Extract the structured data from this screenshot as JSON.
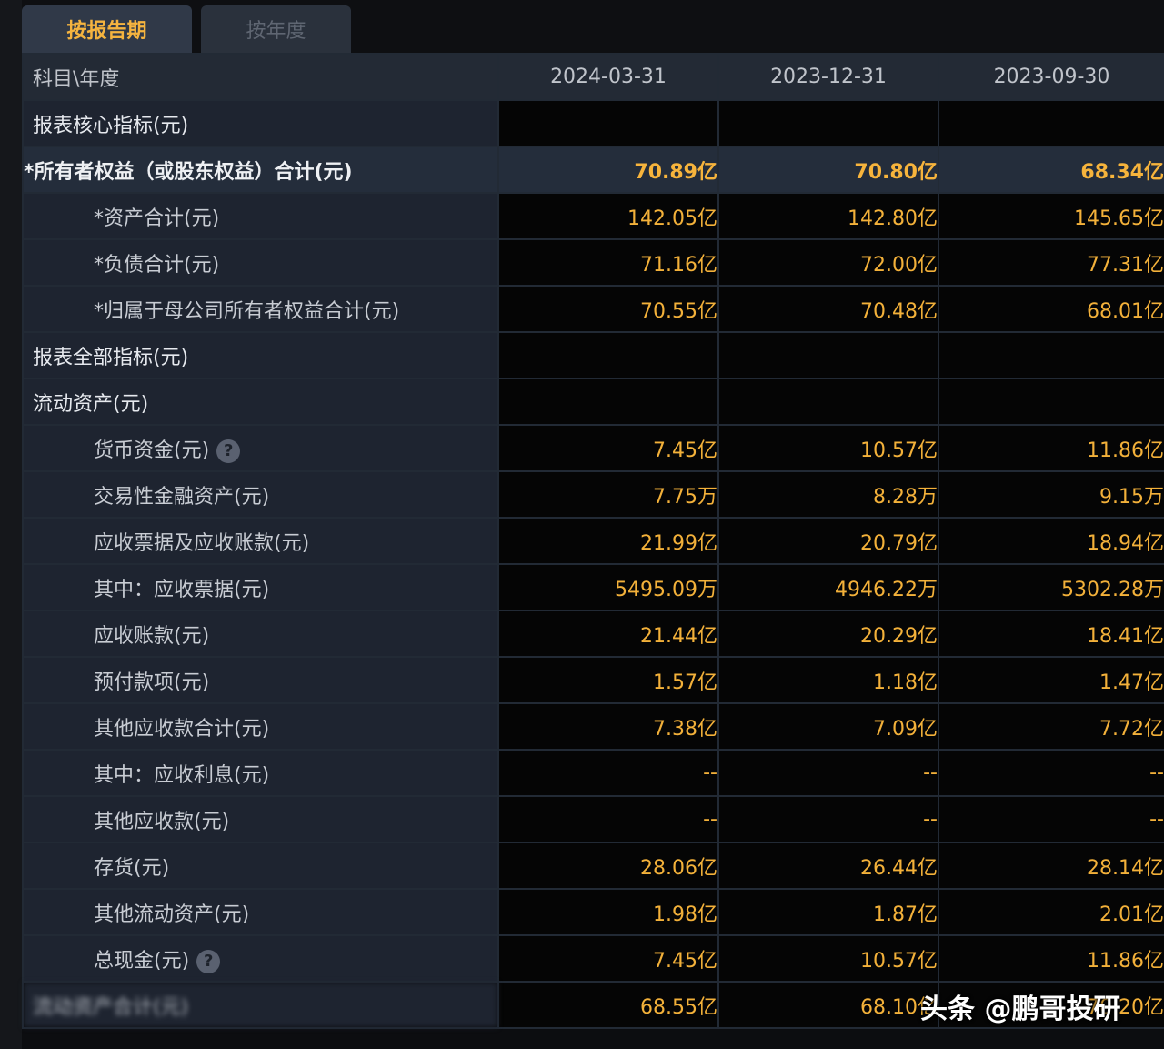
{
  "tabs": [
    {
      "label": "按报告期",
      "active": true
    },
    {
      "label": "按年度",
      "active": false
    }
  ],
  "table": {
    "header_label": "科目\\年度",
    "dates": [
      "2024-03-31",
      "2023-12-31",
      "2023-09-30"
    ],
    "rows": [
      {
        "label": "报表核心指标(元)",
        "kind": "section",
        "values": [
          "",
          "",
          ""
        ]
      },
      {
        "label": "*所有者权益（或股东权益）合计(元)",
        "kind": "highlight",
        "values": [
          "70.89亿",
          "70.80亿",
          "68.34亿"
        ]
      },
      {
        "label": "*资产合计(元)",
        "kind": "item",
        "values": [
          "142.05亿",
          "142.80亿",
          "145.65亿"
        ]
      },
      {
        "label": "*负债合计(元)",
        "kind": "item",
        "values": [
          "71.16亿",
          "72.00亿",
          "77.31亿"
        ]
      },
      {
        "label": "*归属于母公司所有者权益合计(元)",
        "kind": "item",
        "values": [
          "70.55亿",
          "70.48亿",
          "68.01亿"
        ]
      },
      {
        "label": "报表全部指标(元)",
        "kind": "section",
        "values": [
          "",
          "",
          ""
        ]
      },
      {
        "label": "流动资产(元)",
        "kind": "section",
        "values": [
          "",
          "",
          ""
        ]
      },
      {
        "label": "货币资金(元)",
        "kind": "item",
        "help": true,
        "values": [
          "7.45亿",
          "10.57亿",
          "11.86亿"
        ]
      },
      {
        "label": "交易性金融资产(元)",
        "kind": "item",
        "values": [
          "7.75万",
          "8.28万",
          "9.15万"
        ]
      },
      {
        "label": "应收票据及应收账款(元)",
        "kind": "item",
        "values": [
          "21.99亿",
          "20.79亿",
          "18.94亿"
        ]
      },
      {
        "label": "其中：应收票据(元)",
        "kind": "item",
        "values": [
          "5495.09万",
          "4946.22万",
          "5302.28万"
        ]
      },
      {
        "label": "应收账款(元)",
        "kind": "item",
        "values": [
          "21.44亿",
          "20.29亿",
          "18.41亿"
        ]
      },
      {
        "label": "预付款项(元)",
        "kind": "item",
        "values": [
          "1.57亿",
          "1.18亿",
          "1.47亿"
        ]
      },
      {
        "label": "其他应收款合计(元)",
        "kind": "item",
        "values": [
          "7.38亿",
          "7.09亿",
          "7.72亿"
        ]
      },
      {
        "label": "其中：应收利息(元)",
        "kind": "item",
        "values": [
          "--",
          "--",
          "--"
        ]
      },
      {
        "label": "其他应收款(元)",
        "kind": "item",
        "values": [
          "--",
          "--",
          "--"
        ]
      },
      {
        "label": "存货(元)",
        "kind": "item",
        "values": [
          "28.06亿",
          "26.44亿",
          "28.14亿"
        ]
      },
      {
        "label": "其他流动资产(元)",
        "kind": "item",
        "values": [
          "1.98亿",
          "1.87亿",
          "2.01亿"
        ]
      },
      {
        "label": "总现金(元)",
        "kind": "item",
        "help": true,
        "values": [
          "7.45亿",
          "10.57亿",
          "11.86亿"
        ]
      },
      {
        "label": "流动资产合计(元)",
        "kind": "blurred",
        "values": [
          "68.55亿",
          "68.10亿",
          "70.20亿"
        ]
      }
    ]
  },
  "help_icon_glyph": "?",
  "watermark": "头条 @鹏哥投研",
  "colors": {
    "value_text": "#f3b13a",
    "active_tab_text": "#f5b43f",
    "label_bg": "#1e2430",
    "value_bg": "#050505"
  }
}
